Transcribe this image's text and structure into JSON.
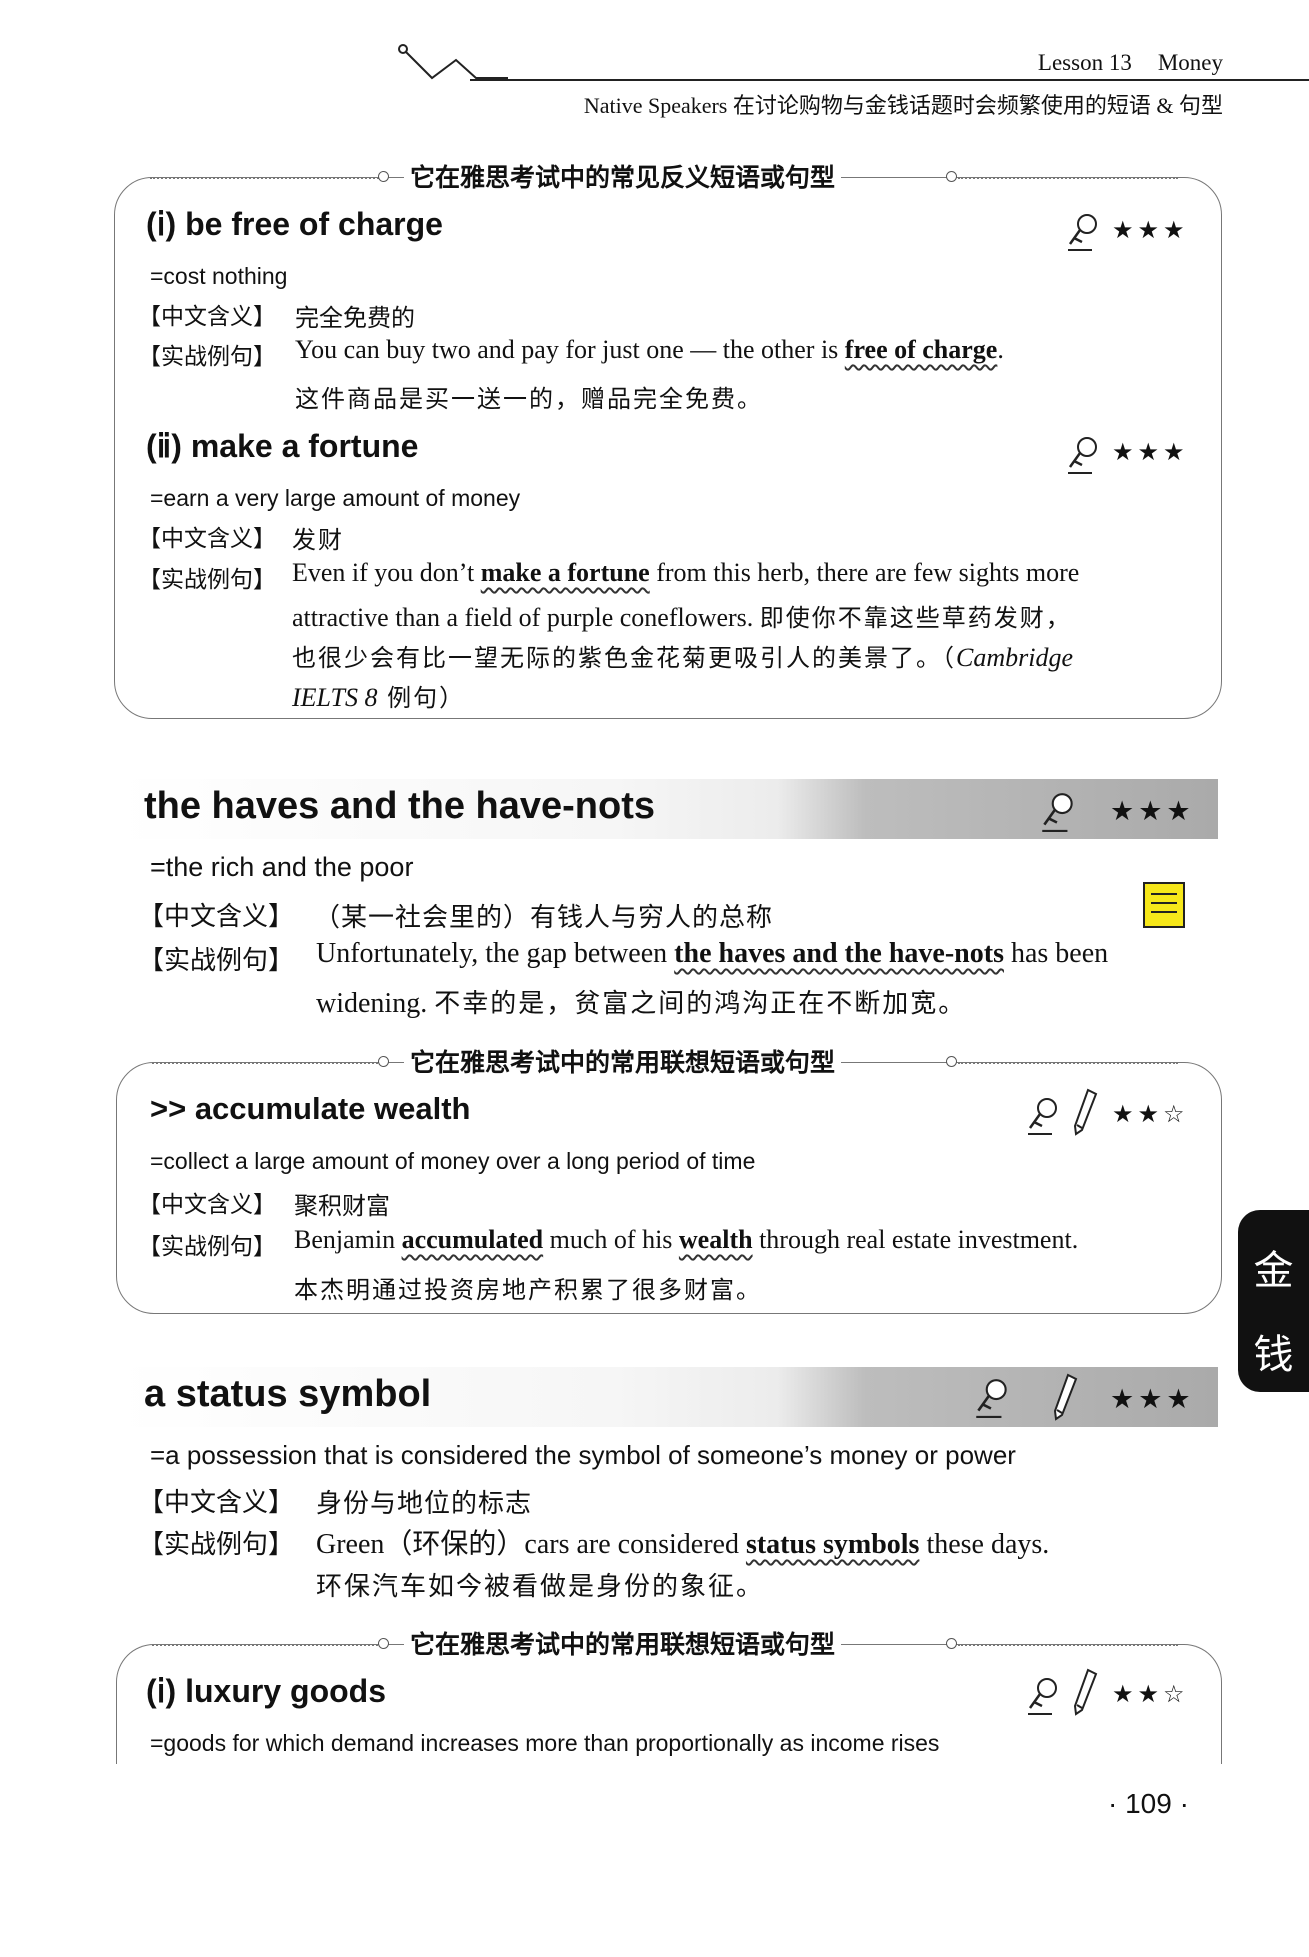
{
  "header": {
    "lesson": "Lesson 13",
    "topic": "Money",
    "subtitle": "Native Speakers 在讨论购物与金钱话题时会频繁使用的短语 & 句型"
  },
  "labels": {
    "zh_meaning": "【中文含义】",
    "example": "【实战例句】"
  },
  "box1": {
    "title": "它在雅思考试中的常见反义短语或句型",
    "items": [
      {
        "num": "(ⅰ)",
        "term": "be free of charge",
        "stars": "★★★",
        "definition": "=cost nothing",
        "zh_meaning": "完全免费的",
        "ex_before": "You can buy two and pay for just one — the other is ",
        "ex_kw": "free of charge",
        "ex_after": ".",
        "zh_example": "这件商品是买一送一的，赠品完全免费。"
      },
      {
        "num": "(ⅱ)",
        "term": "make a fortune",
        "stars": "★★★",
        "definition": "=earn a very large amount of money",
        "zh_meaning": "发财",
        "ex1_before": "Even if you don’t ",
        "ex1_kw": "make a fortune",
        "ex1_after": " from this herb, there are few sights more",
        "ex2_en": "attractive than a field of purple coneflowers. ",
        "ex2_zh": "即使你不靠这些草药发财，",
        "ex3_zh": "也很少会有比一望无际的紫色金花菊更吸引人的美景了。（",
        "ex3_src": "Cambridge",
        "ex4_src": "IELTS 8",
        "ex4_zh": " 例句）"
      }
    ]
  },
  "section1": {
    "term": "the haves and the have-nots",
    "stars": "★★★",
    "definition": "=the rich and the poor",
    "zh_meaning": "（某一社会里的）有钱人与穷人的总称",
    "ex_before": "Unfortunately, the gap between ",
    "ex_kw": "the haves and the have-nots",
    "ex_after": " has been",
    "ex2_en": "widening. ",
    "ex2_zh": "不幸的是，贫富之间的鸿沟正在不断加宽。"
  },
  "box2": {
    "title": "它在雅思考试中的常用联想短语或句型",
    "term": ">> accumulate wealth",
    "stars": "★★☆",
    "definition": "=collect a large amount of money over a long period of time",
    "zh_meaning": "聚积财富",
    "ex_before": "Benjamin ",
    "ex_kw1": "accumulated",
    "ex_mid": " much of his ",
    "ex_kw2": "wealth",
    "ex_after": " through real estate investment.",
    "zh_example": "本杰明通过投资房地产积累了很多财富。"
  },
  "section2": {
    "term": "a status symbol",
    "stars": "★★★",
    "definition": "=a possession that is considered the symbol of someone’s money or power",
    "zh_meaning": "身份与地位的标志",
    "ex_before": "Green（环保的）cars are considered ",
    "ex_kw": "status symbols",
    "ex_after": " these days.",
    "zh_example": "环保汽车如今被看做是身份的象征。"
  },
  "box3": {
    "title": "它在雅思考试中的常用联想短语或句型",
    "num": "(ⅰ)",
    "term": "luxury goods",
    "stars": "★★☆",
    "definition": "=goods for which demand increases more than proportionally as income rises"
  },
  "side_tab": [
    "金",
    "钱"
  ],
  "page_number": "· 109 ·"
}
